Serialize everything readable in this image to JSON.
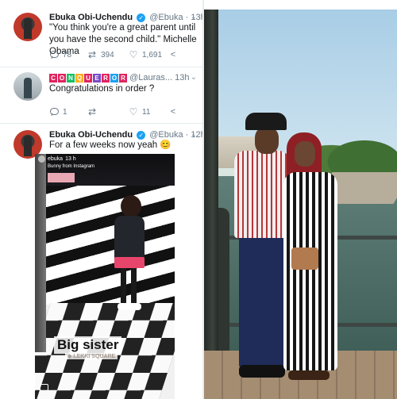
{
  "tweets": [
    {
      "name": "Ebuka Obi-Uchendu",
      "handle": "@Ebuka",
      "time": "13h",
      "text": "\"You think you're a great parent until you have the second child.\" Michelle Obama",
      "replies": "78",
      "retweets": "394",
      "likes": "1,691"
    },
    {
      "name_letters": [
        "C",
        "O",
        "N",
        "Q",
        "U",
        "E",
        "R",
        "O",
        "R"
      ],
      "handle": "@Lauras...",
      "time": "13h",
      "text": "Congratulations in order ?",
      "replies": "1",
      "retweets": "",
      "likes": "11"
    },
    {
      "name": "Ebuka Obi-Uchendu",
      "handle": "@Ebuka",
      "time": "12h",
      "text": "For a few weeks now yeah 😊"
    }
  ],
  "story": {
    "user": "ebuka",
    "time": "13 h",
    "subtitle": "Bunny from Instagram",
    "caption": "Big sister",
    "location": "◈ LEKKI SQUARE"
  },
  "icons": {
    "reply": "reply-icon",
    "retweet": "retweet-icon",
    "like": "heart-icon",
    "share": "share-icon",
    "verified": "verified-badge-icon",
    "caret": "chevron-down-icon"
  },
  "colors": {
    "verified": "#1da1f2",
    "meta": "#657786",
    "text": "#14171a"
  }
}
